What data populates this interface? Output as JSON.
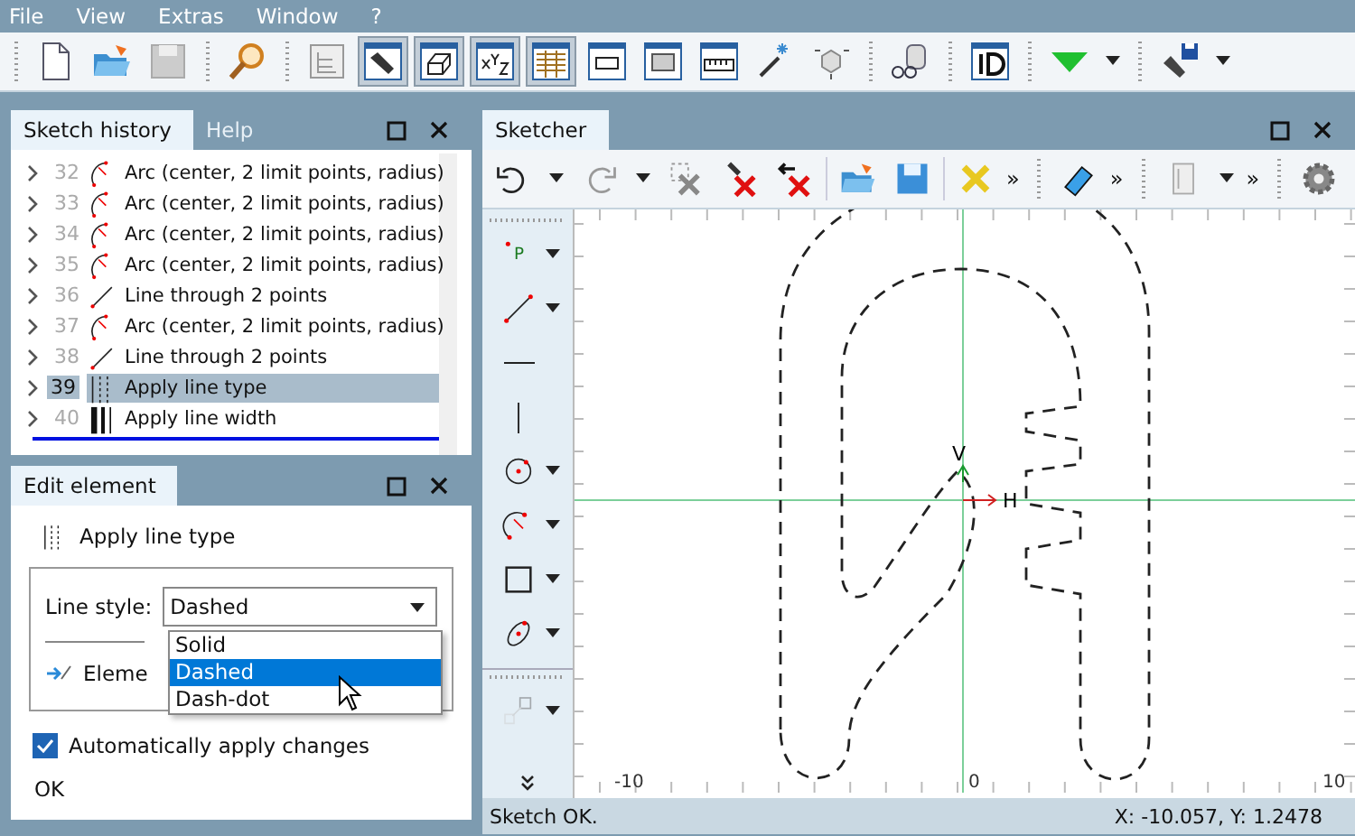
{
  "menu": [
    "File",
    "View",
    "Extras",
    "Window",
    "?"
  ],
  "main_toolbar": {
    "groups": [
      [
        {
          "pressed": false
        },
        {
          "pressed": false
        },
        {
          "pressed": false
        }
      ],
      [
        {
          "pressed": false
        }
      ],
      [
        {
          "pressed": false
        },
        {
          "pressed": true
        },
        {
          "pressed": true
        },
        {
          "pressed": true
        },
        {
          "pressed": true
        },
        {
          "pressed": false
        },
        {
          "pressed": false
        },
        {
          "pressed": false
        },
        {
          "pressed": false
        },
        {
          "pressed": false
        }
      ],
      [
        {
          "pressed": false
        }
      ],
      [
        {
          "pressed": false
        }
      ],
      [
        {
          "pressed": false,
          "dropdown": true
        }
      ],
      [
        {
          "pressed": false,
          "dropdown": true
        }
      ]
    ]
  },
  "history_panel": {
    "tabs": [
      {
        "label": "Sketch history",
        "selected": true
      },
      {
        "label": "Help",
        "selected": false
      }
    ],
    "items": [
      {
        "number": "32",
        "label": "Arc (center, 2 limit points, radius)",
        "kind": "arc",
        "selected": false
      },
      {
        "number": "33",
        "label": "Arc (center, 2 limit points, radius)",
        "kind": "arc",
        "selected": false
      },
      {
        "number": "34",
        "label": "Arc (center, 2 limit points, radius)",
        "kind": "arc",
        "selected": false
      },
      {
        "number": "35",
        "label": "Arc (center, 2 limit points, radius)",
        "kind": "arc",
        "selected": false
      },
      {
        "number": "36",
        "label": "Line through 2 points",
        "kind": "line",
        "selected": false
      },
      {
        "number": "37",
        "label": "Arc (center, 2 limit points, radius)",
        "kind": "arc",
        "selected": false
      },
      {
        "number": "38",
        "label": "Line through 2 points",
        "kind": "line",
        "selected": false
      },
      {
        "number": "39",
        "label": "Apply line type",
        "kind": "linetype",
        "selected": true
      },
      {
        "number": "40",
        "label": "Apply line width",
        "kind": "linewidth",
        "selected": false
      }
    ]
  },
  "edit_panel": {
    "tab": "Edit element",
    "operation": "Apply line type",
    "line_style_label": "Line style:",
    "line_style_value": "Dashed",
    "options": [
      {
        "label": "Solid",
        "selected": false
      },
      {
        "label": "Dashed",
        "selected": true
      },
      {
        "label": "Dash-dot",
        "selected": false
      }
    ],
    "element_label": "Eleme",
    "auto_apply": {
      "label": "Automatically apply changes",
      "checked": true
    },
    "ok": "OK"
  },
  "sketcher": {
    "tab": "Sketcher",
    "toolbar_more": [
      "»",
      "»",
      "»"
    ],
    "tools": [
      {
        "label": "P",
        "dropdown": true,
        "disabled": false
      },
      {
        "dropdown": true,
        "disabled": false
      },
      {
        "dropdown": false,
        "disabled": false
      },
      {
        "dropdown": false,
        "disabled": false
      },
      {
        "dropdown": true,
        "disabled": false
      },
      {
        "dropdown": true,
        "disabled": false
      },
      {
        "dropdown": true,
        "disabled": false
      },
      {
        "dropdown": true,
        "disabled": false
      },
      {
        "dropdown": true,
        "disabled": true
      }
    ],
    "axis_labels": {
      "vertical": "V",
      "horizontal": "H",
      "x_min": "-10",
      "x_zero": "0",
      "x_max": "10"
    },
    "status": "Sketch OK.",
    "coordinates": "X: -10.057, Y: 1.2478"
  }
}
